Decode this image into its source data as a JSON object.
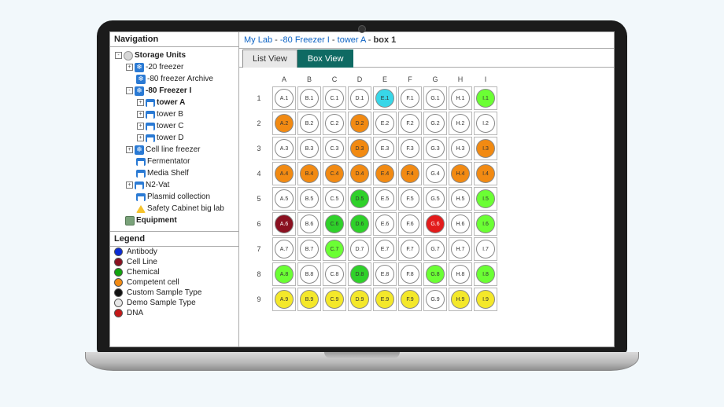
{
  "nav_title": "Navigation",
  "legend_title": "Legend",
  "breadcrumb": {
    "lab": "My Lab",
    "freezer": "-80 Freezer I",
    "tower": "tower A",
    "box": "box 1",
    "sep": " - "
  },
  "tabs": {
    "list": "List View",
    "box": "Box View",
    "active": "box"
  },
  "tree": [
    {
      "lvl": 0,
      "exp": "-",
      "icon": "db",
      "label": "Storage Units",
      "bold": true
    },
    {
      "lvl": 1,
      "exp": "+",
      "icon": "frz",
      "label": "-20 freezer"
    },
    {
      "lvl": 1,
      "exp": "",
      "icon": "frz",
      "label": "-80 freezer Archive"
    },
    {
      "lvl": 1,
      "exp": "-",
      "icon": "frz",
      "label": "-80 Freezer I",
      "bold": true
    },
    {
      "lvl": 2,
      "exp": "+",
      "icon": "rack",
      "label": "tower A",
      "bold": true
    },
    {
      "lvl": 2,
      "exp": "+",
      "icon": "rack",
      "label": "tower B"
    },
    {
      "lvl": 2,
      "exp": "+",
      "icon": "rack",
      "label": "tower C"
    },
    {
      "lvl": 2,
      "exp": "+",
      "icon": "rack",
      "label": "tower D"
    },
    {
      "lvl": 1,
      "exp": "+",
      "icon": "frz",
      "label": "Cell line freezer"
    },
    {
      "lvl": 1,
      "exp": "",
      "icon": "rack",
      "label": "Fermentator"
    },
    {
      "lvl": 1,
      "exp": "",
      "icon": "rack",
      "label": "Media Shelf"
    },
    {
      "lvl": 1,
      "exp": "+",
      "icon": "rack",
      "label": "N2-Vat"
    },
    {
      "lvl": 1,
      "exp": "",
      "icon": "rack",
      "label": "Plasmid collection"
    },
    {
      "lvl": 1,
      "exp": "",
      "icon": "warn",
      "label": "Safety Cabinet big lab"
    },
    {
      "lvl": 0,
      "exp": "",
      "icon": "eq",
      "label": "Equipment",
      "bold": true
    }
  ],
  "legend": [
    {
      "label": "Antibody",
      "color": "#0a2bd6"
    },
    {
      "label": "Cell Line",
      "color": "#8a1020"
    },
    {
      "label": "Chemical",
      "color": "#12a40e"
    },
    {
      "label": "Competent cell",
      "color": "#f28a12"
    },
    {
      "label": "Custom Sample Type",
      "color": "#111111"
    },
    {
      "label": "Demo Sample Type",
      "color": "#e6e6e6"
    },
    {
      "label": "DNA",
      "color": "#c41818"
    }
  ],
  "colors": {
    "empty": "#ffffff",
    "orange": "#f28a12",
    "cyan": "#38d7e8",
    "green": "#2fd12a",
    "bgreen": "#6bff34",
    "darkred": "#8a1020",
    "red": "#e21b1b",
    "yellow": "#f4e82a"
  },
  "grid": {
    "cols": [
      "A",
      "B",
      "C",
      "D",
      "E",
      "F",
      "G",
      "H",
      "I"
    ],
    "rows": [
      "1",
      "2",
      "3",
      "4",
      "5",
      "6",
      "7",
      "8",
      "9"
    ],
    "cells": [
      [
        "empty",
        "empty",
        "empty",
        "empty",
        "cyan",
        "empty",
        "empty",
        "empty",
        "bgreen"
      ],
      [
        "orange",
        "empty",
        "empty",
        "orange",
        "empty",
        "empty",
        "empty",
        "empty",
        "empty"
      ],
      [
        "empty",
        "empty",
        "empty",
        "orange",
        "empty",
        "empty",
        "empty",
        "empty",
        "orange"
      ],
      [
        "orange",
        "orange",
        "orange",
        "orange",
        "orange",
        "orange",
        "empty",
        "orange",
        "orange"
      ],
      [
        "empty",
        "empty",
        "empty",
        "green",
        "empty",
        "empty",
        "empty",
        "empty",
        "bgreen"
      ],
      [
        "darkred",
        "empty",
        "green",
        "green",
        "empty",
        "empty",
        "red",
        "empty",
        "bgreen"
      ],
      [
        "empty",
        "empty",
        "bgreen",
        "empty",
        "empty",
        "empty",
        "empty",
        "empty",
        "empty"
      ],
      [
        "bgreen",
        "empty",
        "empty",
        "green",
        "empty",
        "empty",
        "bgreen",
        "empty",
        "bgreen"
      ],
      [
        "yellow",
        "yellow",
        "yellow",
        "yellow",
        "yellow",
        "yellow",
        "empty",
        "yellow",
        "yellow"
      ]
    ]
  }
}
